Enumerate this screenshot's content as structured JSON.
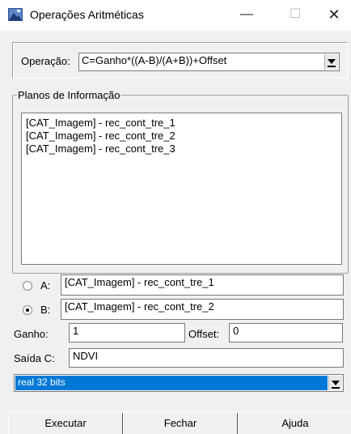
{
  "window": {
    "title": "Operações Aritméticas",
    "minimize_glyph": "—",
    "maximize_glyph": "☐",
    "close_glyph": "✕",
    "icon": "app-image-icon"
  },
  "operation": {
    "label": "Operação:",
    "selected": "C=Ganho*((A-B)/(A+B))+Offset"
  },
  "info_planes": {
    "legend": "Planos de Informação",
    "items": [
      "[CAT_Imagem] - rec_cont_tre_1",
      "[CAT_Imagem] - rec_cont_tre_2",
      "[CAT_Imagem] - rec_cont_tre_3"
    ]
  },
  "operands": {
    "a_label": "A:",
    "a_value": "[CAT_Imagem] - rec_cont_tre_1",
    "a_selected": false,
    "b_label": "B:",
    "b_value": "[CAT_Imagem] - rec_cont_tre_2",
    "b_selected": true
  },
  "gain": {
    "label": "Ganho:",
    "value": "1"
  },
  "offset": {
    "label": "Offset:",
    "value": "0"
  },
  "output": {
    "label": "Saída C:",
    "value": "NDVI"
  },
  "data_type": {
    "selected": "real 32 bits"
  },
  "buttons": {
    "execute": "Executar",
    "close": "Fechar",
    "help": "Ajuda"
  },
  "colors": {
    "selection": "#0078d7",
    "window_bg": "#f0f0f0"
  }
}
